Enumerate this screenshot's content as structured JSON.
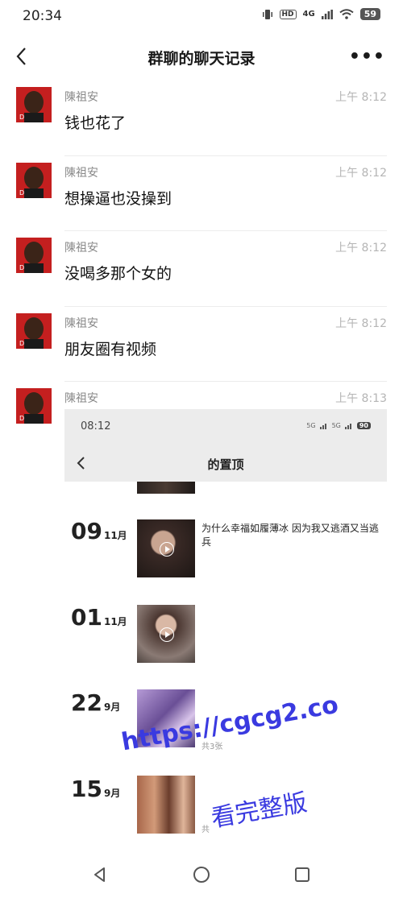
{
  "status_bar": {
    "time": "20:34",
    "network": "4G",
    "hd": "HD",
    "battery": "59"
  },
  "header": {
    "title": "群聊的聊天记录",
    "more": "•••"
  },
  "messages": [
    {
      "name": "陳祖安",
      "time": "上午 8:12",
      "text": "钱也花了"
    },
    {
      "name": "陳祖安",
      "time": "上午 8:12",
      "text": "想操逼也没操到"
    },
    {
      "name": "陳祖安",
      "time": "上午 8:12",
      "text": "没喝多那个女的"
    },
    {
      "name": "陳祖安",
      "time": "上午 8:12",
      "text": "朋友圈有视频"
    },
    {
      "name": "陳祖安",
      "time": "上午 8:13",
      "text": ""
    }
  ],
  "embedded_screenshot": {
    "status_time": "08:12",
    "signal_a": "5G",
    "signal_b": "5G",
    "battery": "90",
    "title": "的置顶",
    "moments": [
      {
        "day": "09",
        "month": "11月",
        "text": "为什么幸福如履薄冰 因为我又逃酒又当逃兵",
        "count": ""
      },
      {
        "day": "01",
        "month": "11月",
        "text": "",
        "count": ""
      },
      {
        "day": "22",
        "month": "9月",
        "text": "",
        "count": "共3张"
      },
      {
        "day": "15",
        "month": "9月",
        "text": "",
        "count": "共"
      }
    ]
  },
  "watermark": {
    "url": "https://cgcg2.co",
    "text": "看完整版"
  },
  "colors": {
    "watermark": "#3a3ae0",
    "avatar_red": "#c41f1f",
    "embed_bar": "#ececec"
  }
}
